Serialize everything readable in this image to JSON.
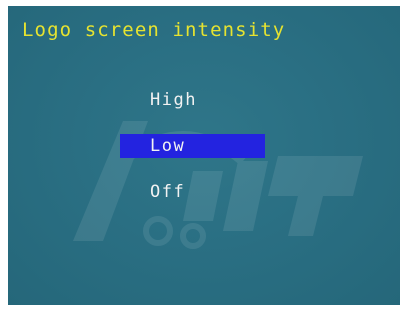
{
  "screen": {
    "title": "Logo screen intensity",
    "background_color": "#2a6f83",
    "title_color": "#e6e330",
    "highlight_color": "#2323e0"
  },
  "menu": {
    "items": [
      {
        "label": "High",
        "selected": false
      },
      {
        "label": "Low",
        "selected": true
      },
      {
        "label": "Off",
        "selected": false
      }
    ]
  },
  "watermark": {
    "icon": "faded-logo-watermark"
  }
}
